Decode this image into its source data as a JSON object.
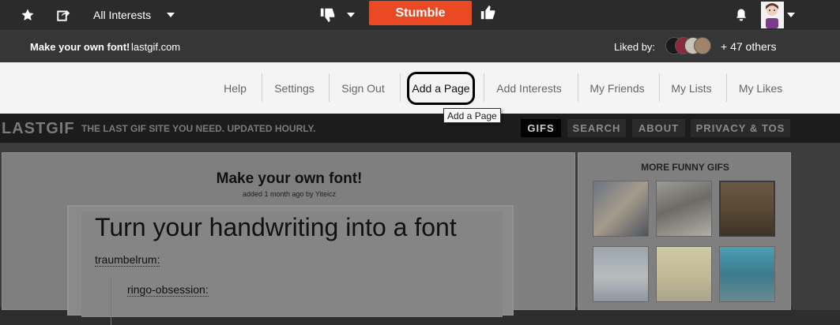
{
  "toolbar": {
    "interest_label": "All Interests",
    "stumble_label": "Stumble"
  },
  "infobar": {
    "page_title": "Make your own font!",
    "domain": "lastgif.com",
    "liked_by_label": "Liked by:",
    "others_label": "+ 47 others"
  },
  "nav": {
    "items": [
      {
        "label": "Help"
      },
      {
        "label": "Settings"
      },
      {
        "label": "Sign Out"
      },
      {
        "label": "Add a Page"
      },
      {
        "label": "Add Interests"
      },
      {
        "label": "My Friends"
      },
      {
        "label": "My Lists"
      },
      {
        "label": "My Likes"
      }
    ],
    "tooltip": "Add a Page"
  },
  "site": {
    "logo": "LASTGIF",
    "tagline": "THE LAST GIF SITE YOU NEED. UPDATED HOURLY.",
    "tabs": [
      {
        "label": "GIFS",
        "active": true
      },
      {
        "label": "SEARCH",
        "active": false
      },
      {
        "label": "ABOUT",
        "active": false
      },
      {
        "label": "PRIVACY & TOS",
        "active": false
      }
    ]
  },
  "post": {
    "title": "Make your own font!",
    "meta": "added 1 month ago by Yiteicz",
    "heading": "Turn your handwriting into a font",
    "user1": "traumbelrum:",
    "user2": "ringo-obsession:"
  },
  "sidebar": {
    "title": "MORE FUNNY GIFS"
  },
  "colors": {
    "accent": "#eb4924",
    "toolbar_bg": "#2b2b2b",
    "nav_bg": "#f4f4f4"
  }
}
